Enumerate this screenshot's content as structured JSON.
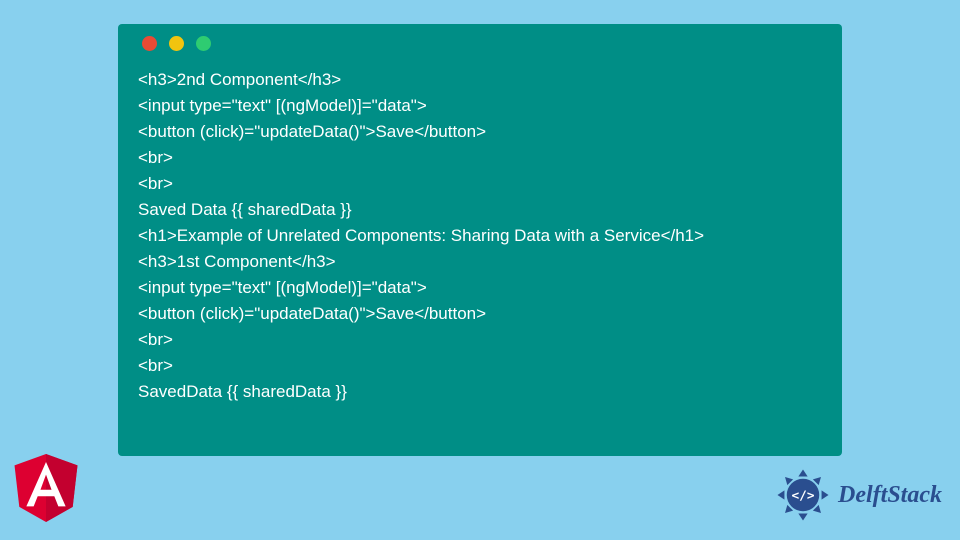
{
  "code": {
    "lines": [
      "<h3>2nd Component</h3>",
      "<input type=\"text\" [(ngModel)]=\"data\">",
      "<button (click)=\"updateData()\">Save</button>",
      "<br>",
      "<br>",
      "Saved Data {{ sharedData }}",
      "<h1>Example of Unrelated Components: Sharing Data with a Service</h1>",
      "<h3>1st Component</h3>",
      "<input type=\"text\" [(ngModel)]=\"data\">",
      "<button (click)=\"updateData()\">Save</button>",
      "<br>",
      "<br>",
      "SavedData {{ sharedData }}"
    ]
  },
  "branding": {
    "delft_label": "DelftStack"
  }
}
